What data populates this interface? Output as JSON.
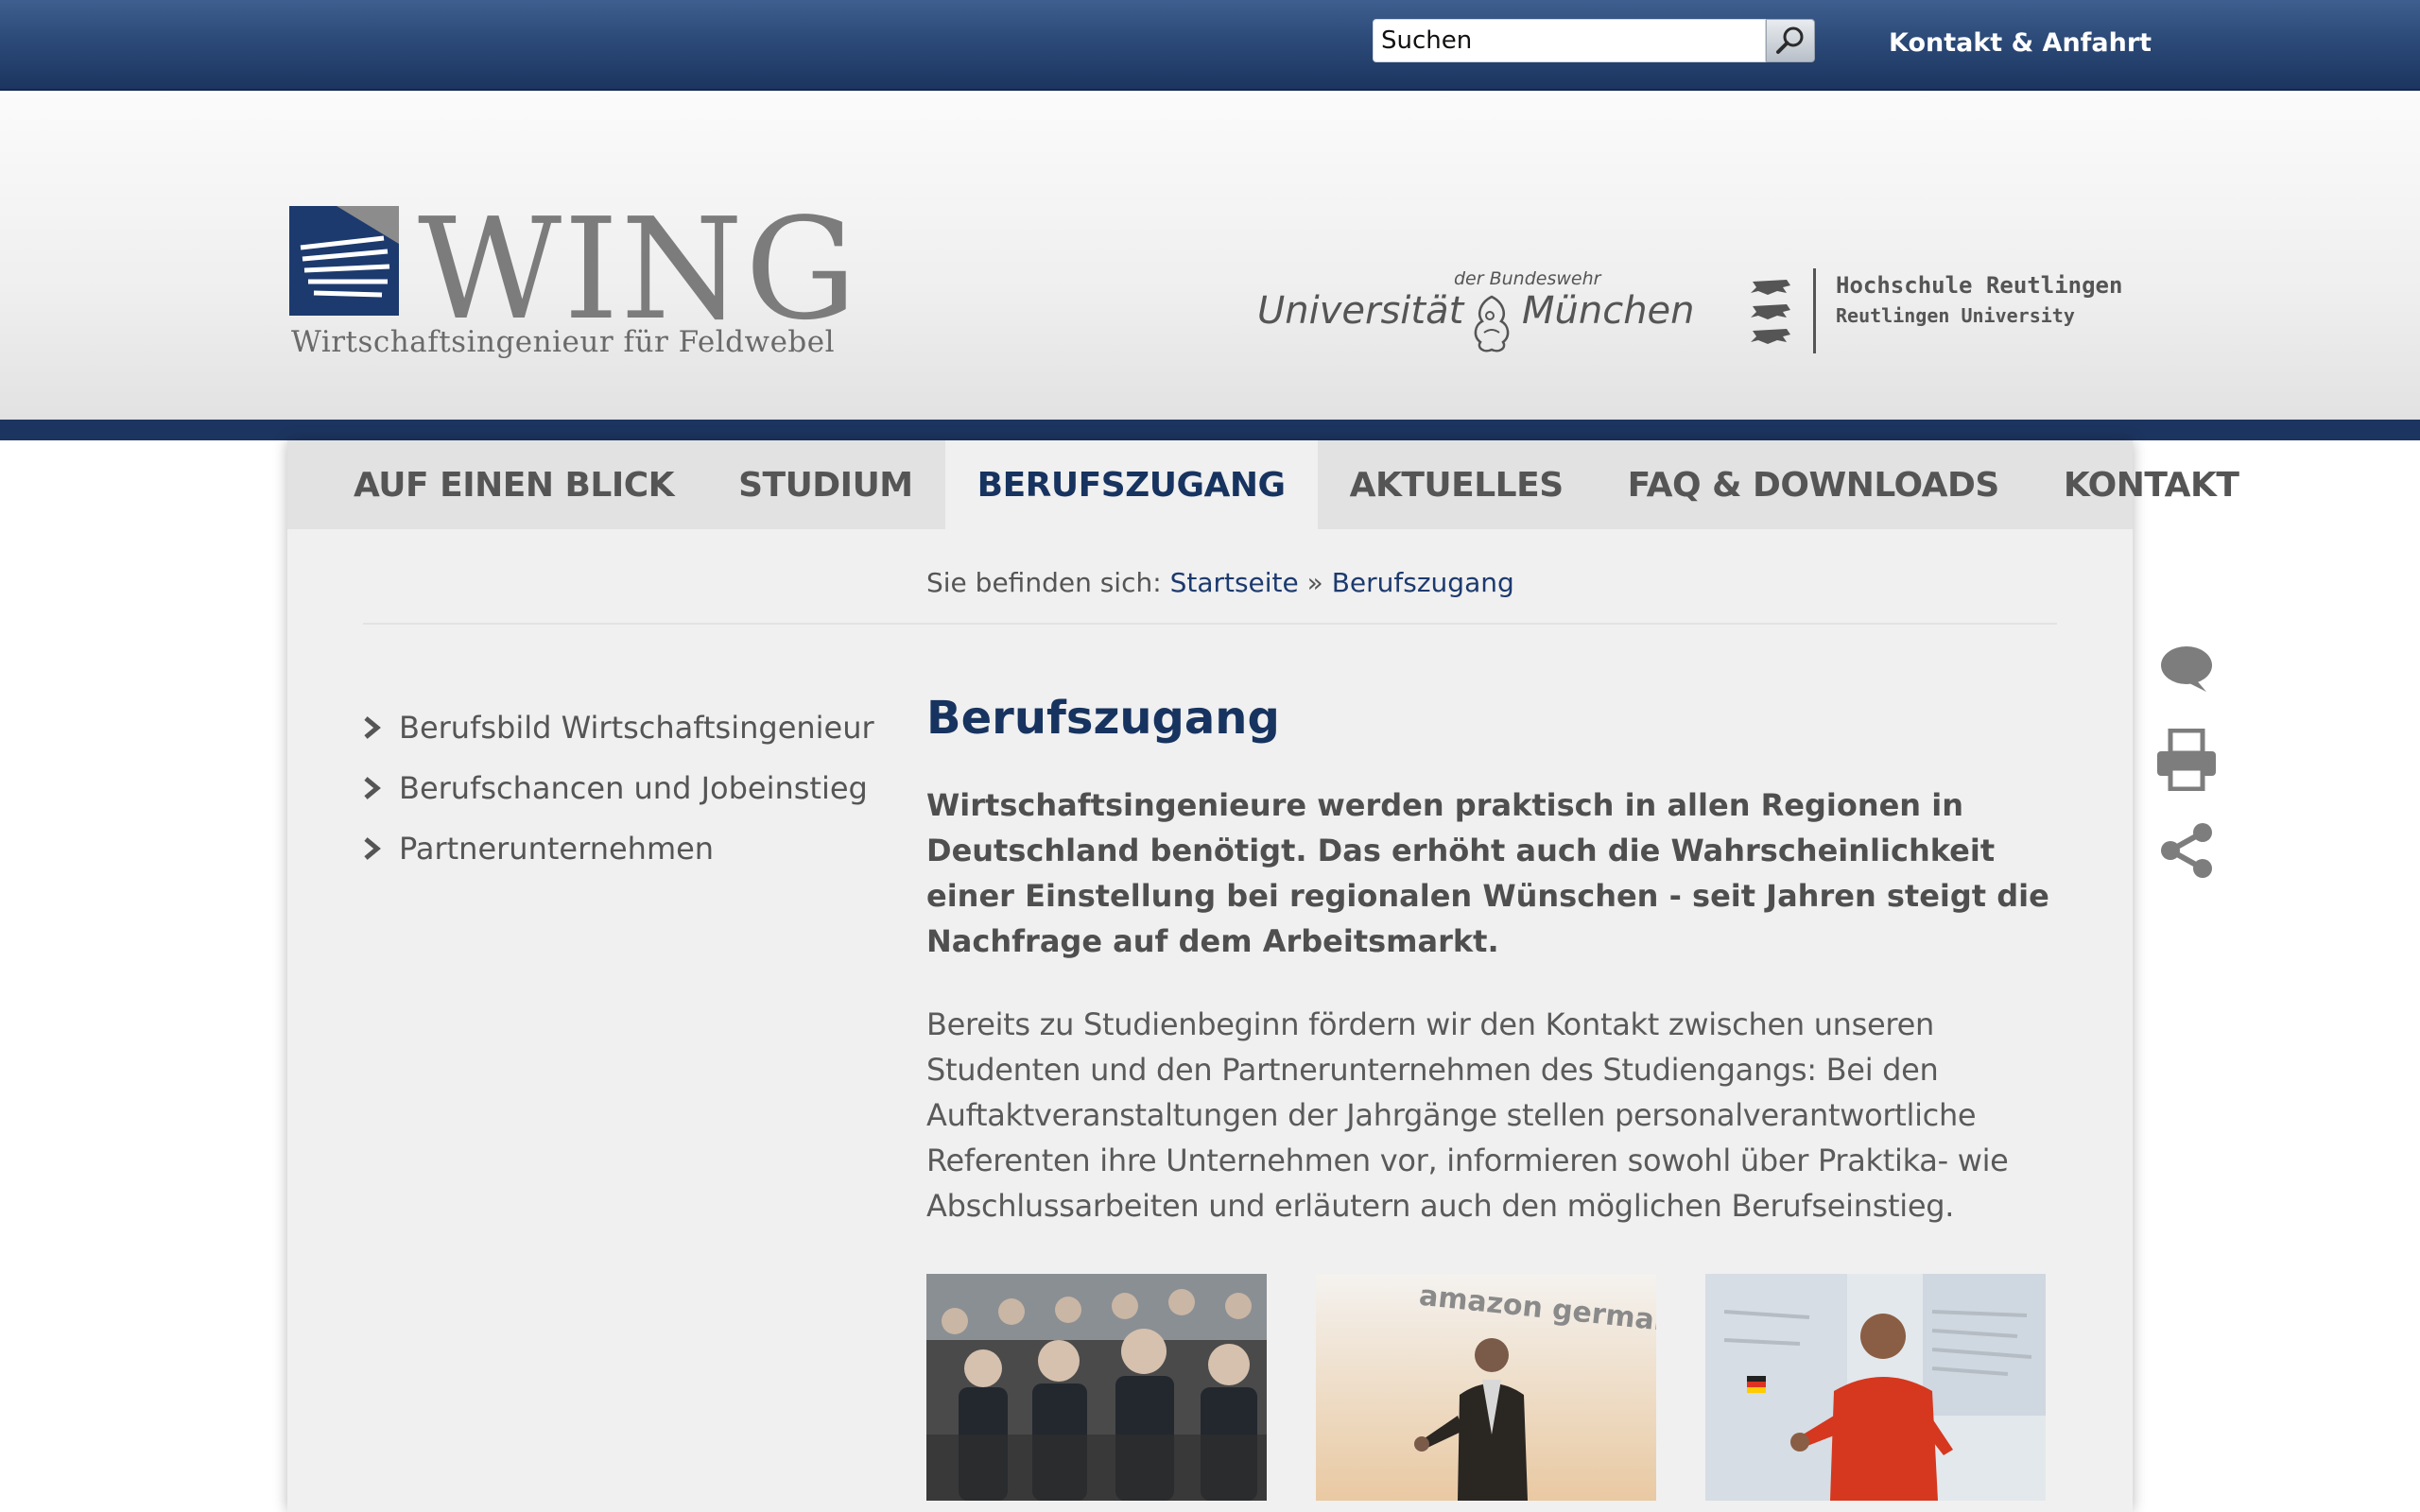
{
  "topbar": {
    "search_placeholder": "Suchen",
    "search_icon": "magnifier-icon",
    "contact_link": "Kontakt & Anfahrt"
  },
  "header": {
    "logo_word": "WING",
    "logo_subtitle": "Wirtschaftsingenieur für Feldwebel",
    "unibw_top": "der Bundeswehr",
    "unibw_left": "Universität",
    "unibw_right": "München",
    "reutlingen_name": "Hochschule Reutlingen",
    "reutlingen_sub": "Reutlingen University"
  },
  "nav": {
    "items": [
      {
        "label": "AUF EINEN BLICK"
      },
      {
        "label": "STUDIUM"
      },
      {
        "label": "BERUFSZUGANG",
        "active": true
      },
      {
        "label": "AKTUELLES"
      },
      {
        "label": "FAQ & DOWNLOADS"
      },
      {
        "label": "KONTAKT"
      }
    ]
  },
  "breadcrumb": {
    "prefix": "Sie befinden sich:",
    "home": "Startseite",
    "separator": "»",
    "current": "Berufszugang"
  },
  "subnav": {
    "items": [
      {
        "label": "Berufsbild Wirtschaftsingenieur"
      },
      {
        "label": "Berufschancen und Jobeinstieg"
      },
      {
        "label": "Partnerunternehmen"
      }
    ]
  },
  "main": {
    "title": "Berufszugang",
    "lead": "Wirtschaftsingenieure werden praktisch in allen Regionen in Deutschland benötigt. Das erhöht auch die Wahrscheinlichkeit einer Einstellung bei regionalen Wünschen - seit Jahren steigt die Nachfrage auf dem Arbeitsmarkt.",
    "body": "Bereits zu Studienbeginn fördern wir den Kontakt zwischen unseren Studenten und den Partnerunternehmen des Studiengangs: Bei den Auftaktveranstaltungen der Jahrgänge stellen personalverantwortliche Referenten ihre Unternehmen vor, informieren sowohl über Praktika- wie Abschlussarbeiten und erläutern auch den möglichen Berufseinstieg.",
    "photo2_banner": "amazon germany"
  },
  "sidetools": [
    "comment-icon",
    "print-icon",
    "share-icon"
  ],
  "colors": {
    "brand_navy": "#1c3560",
    "link": "#1c3a6e",
    "panel_bg": "#f0f0f0",
    "nav_bg": "#e2e2e2"
  }
}
